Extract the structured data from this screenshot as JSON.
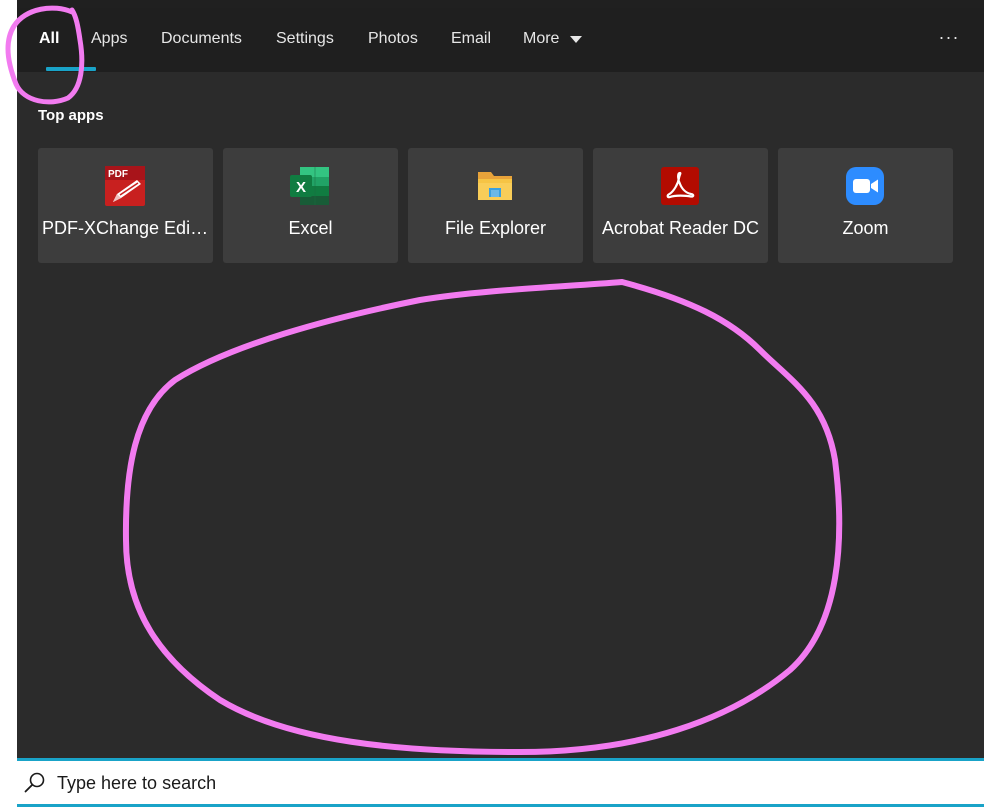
{
  "nav": {
    "tabs": [
      {
        "label": "All",
        "active": true
      },
      {
        "label": "Apps"
      },
      {
        "label": "Documents"
      },
      {
        "label": "Settings"
      },
      {
        "label": "Photos"
      },
      {
        "label": "Email"
      },
      {
        "label": "More"
      }
    ],
    "more_options_label": "···"
  },
  "top_apps": {
    "title": "Top apps",
    "items": [
      {
        "label": "PDF-XChange Editor",
        "icon": "pdf-xchange-icon"
      },
      {
        "label": "Excel",
        "icon": "excel-icon"
      },
      {
        "label": "File Explorer",
        "icon": "file-explorer-icon"
      },
      {
        "label": "Acrobat Reader DC",
        "icon": "acrobat-reader-icon"
      },
      {
        "label": "Zoom",
        "icon": "zoom-icon"
      }
    ]
  },
  "search": {
    "placeholder": "Type here to search",
    "value": ""
  },
  "colors": {
    "accent": "#19a3c8",
    "panel": "#2b2b2b",
    "tile": "#3d3d3d",
    "annotation": "#f27bf0"
  }
}
